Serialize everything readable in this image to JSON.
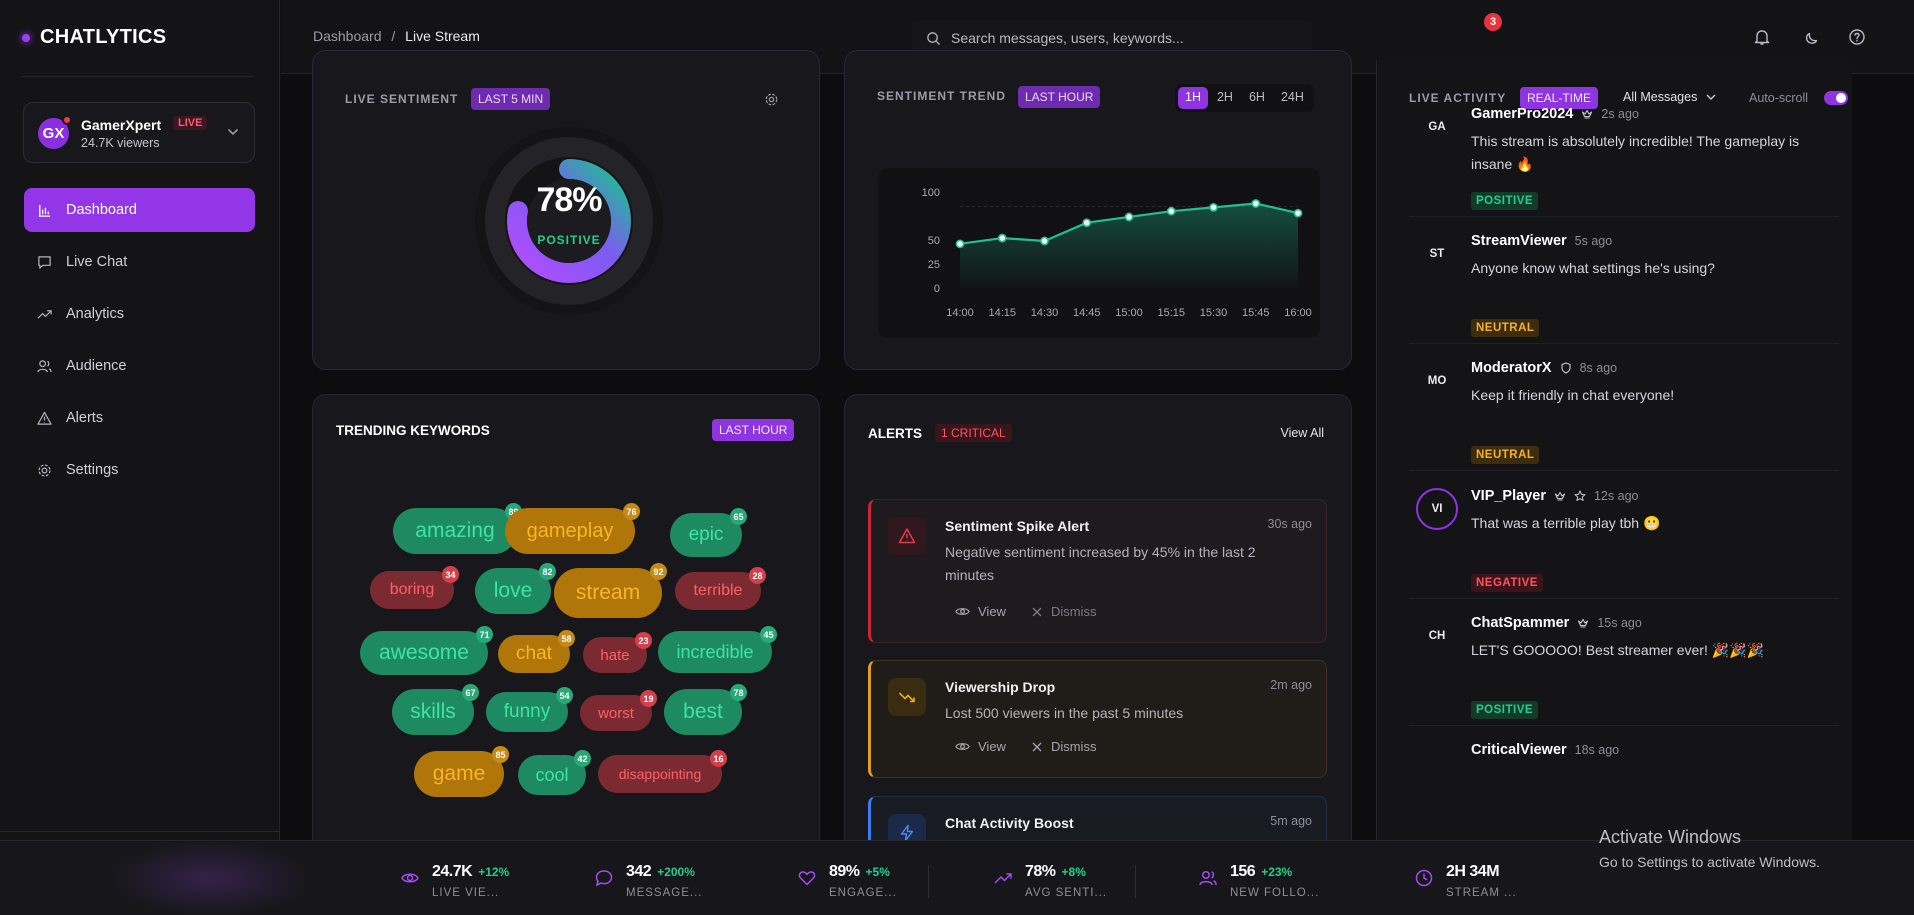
{
  "brand": {
    "name": "CHATLYTICS"
  },
  "profile": {
    "initials": "GX",
    "name": "GamerXpert",
    "live_label": "LIVE",
    "viewers": "24.7K viewers"
  },
  "nav": [
    {
      "label": "Dashboard",
      "icon": "bar-chart-icon",
      "active": true
    },
    {
      "label": "Live Chat",
      "icon": "chat-bubble-icon",
      "active": false
    },
    {
      "label": "Analytics",
      "icon": "trending-up-icon",
      "active": false
    },
    {
      "label": "Audience",
      "icon": "users-icon",
      "active": false
    },
    {
      "label": "Alerts",
      "icon": "warning-triangle-icon",
      "active": false
    },
    {
      "label": "Settings",
      "icon": "gear-icon",
      "active": false
    }
  ],
  "topbar": {
    "breadcrumb": {
      "root": "Dashboard",
      "separator": "/",
      "current": "Live Stream"
    },
    "search_placeholder": "Search messages, users, keywords...",
    "notifications": "3"
  },
  "sentiment": {
    "title": "LIVE SENTIMENT",
    "badge": "LAST 5 MIN",
    "value": "78%",
    "label": "POSITIVE",
    "level": 0.78
  },
  "trend": {
    "title": "SENTIMENT TREND",
    "badge": "LAST HOUR",
    "ranges": [
      "1H",
      "2H",
      "6H",
      "24H"
    ],
    "active_range": "1H"
  },
  "chart_data": {
    "type": "area",
    "x": [
      "14:00",
      "14:15",
      "14:30",
      "14:45",
      "15:00",
      "15:15",
      "15:30",
      "15:45",
      "16:00"
    ],
    "values": [
      46,
      52,
      49,
      68,
      74,
      80,
      84,
      88,
      78
    ],
    "yticks": [
      0,
      25,
      50,
      100
    ],
    "ylim": [
      0,
      100
    ],
    "color": "#22c08a"
  },
  "keywords": {
    "title": "TRENDING KEYWORDS",
    "badge": "LAST HOUR",
    "items": [
      {
        "word": "amazing",
        "count": "89",
        "sentiment": "pos"
      },
      {
        "word": "gameplay",
        "count": "76",
        "sentiment": "neu"
      },
      {
        "word": "epic",
        "count": "65",
        "sentiment": "pos"
      },
      {
        "word": "boring",
        "count": "34",
        "sentiment": "neg"
      },
      {
        "word": "love",
        "count": "82",
        "sentiment": "pos"
      },
      {
        "word": "stream",
        "count": "92",
        "sentiment": "neu"
      },
      {
        "word": "terrible",
        "count": "28",
        "sentiment": "neg"
      },
      {
        "word": "awesome",
        "count": "71",
        "sentiment": "pos"
      },
      {
        "word": "chat",
        "count": "58",
        "sentiment": "neu"
      },
      {
        "word": "hate",
        "count": "23",
        "sentiment": "neg"
      },
      {
        "word": "incredible",
        "count": "45",
        "sentiment": "pos"
      },
      {
        "word": "skills",
        "count": "67",
        "sentiment": "pos"
      },
      {
        "word": "funny",
        "count": "54",
        "sentiment": "pos"
      },
      {
        "word": "worst",
        "count": "19",
        "sentiment": "neg"
      },
      {
        "word": "best",
        "count": "78",
        "sentiment": "pos"
      },
      {
        "word": "game",
        "count": "85",
        "sentiment": "neu"
      },
      {
        "word": "cool",
        "count": "42",
        "sentiment": "pos"
      },
      {
        "word": "disappointing",
        "count": "16",
        "sentiment": "neg"
      }
    ]
  },
  "alerts": {
    "title": "ALERTS",
    "badge": "1 CRITICAL",
    "view_all": "View All",
    "view_label": "View",
    "dismiss_label": "Dismiss",
    "items": [
      {
        "title": "Sentiment Spike Alert",
        "time": "30s ago",
        "desc": "Negative sentiment increased by 45% in the last 2 minutes"
      },
      {
        "title": "Viewership Drop",
        "time": "2m ago",
        "desc": "Lost 500 viewers in the past 5 minutes"
      },
      {
        "title": "Chat Activity Boost",
        "time": "5m ago"
      }
    ]
  },
  "activity": {
    "title": "LIVE ACTIVITY",
    "badge": "REAL-TIME",
    "filter": "All Messages",
    "autoscroll_label": "Auto-scroll",
    "autoscroll_on": true,
    "messages": [
      {
        "initials": "GA",
        "user": "GamerPro2024",
        "time": "2s ago",
        "text": "This stream is absolutely incredible! The gameplay is insane 🔥",
        "tag": "POSITIVE"
      },
      {
        "initials": "ST",
        "user": "StreamViewer",
        "time": "5s ago",
        "text": "Anyone know what settings he's using?",
        "tag": "NEUTRAL"
      },
      {
        "initials": "MO",
        "user": "ModeratorX",
        "time": "8s ago",
        "text": "Keep it friendly in chat everyone!",
        "tag": "NEUTRAL"
      },
      {
        "initials": "VI",
        "user": "VIP_Player",
        "time": "12s ago",
        "text": "That was a terrible play tbh 😬",
        "tag": "NEGATIVE"
      },
      {
        "initials": "CH",
        "user": "ChatSpammer",
        "time": "15s ago",
        "text": "LET'S GOOOOO! Best streamer ever! 🎉🎉🎉",
        "tag": "POSITIVE"
      },
      {
        "initials": "",
        "user": "CriticalViewer",
        "time": "18s ago"
      }
    ]
  },
  "stats": [
    {
      "value": "24.7K",
      "delta": "+12%",
      "label": "LIVE VIE...",
      "icon": "eye-icon"
    },
    {
      "value": "342",
      "delta": "+200%",
      "label": "MESSAGE...",
      "icon": "chat-bubble-icon"
    },
    {
      "value": "89%",
      "delta": "+5%",
      "label": "ENGAGE...",
      "icon": "heart-icon"
    },
    {
      "value": "78%",
      "delta": "+8%",
      "label": "AVG SENTI...",
      "icon": "trending-up-icon"
    },
    {
      "value": "156",
      "delta": "+23%",
      "label": "NEW FOLLO...",
      "icon": "users-icon"
    },
    {
      "value": "2H 34M",
      "delta": "",
      "label": "STREAM ...",
      "icon": "clock-icon"
    }
  ],
  "watermark": {
    "line1": "Activate Windows",
    "line2": "Go to Settings to activate Windows."
  }
}
